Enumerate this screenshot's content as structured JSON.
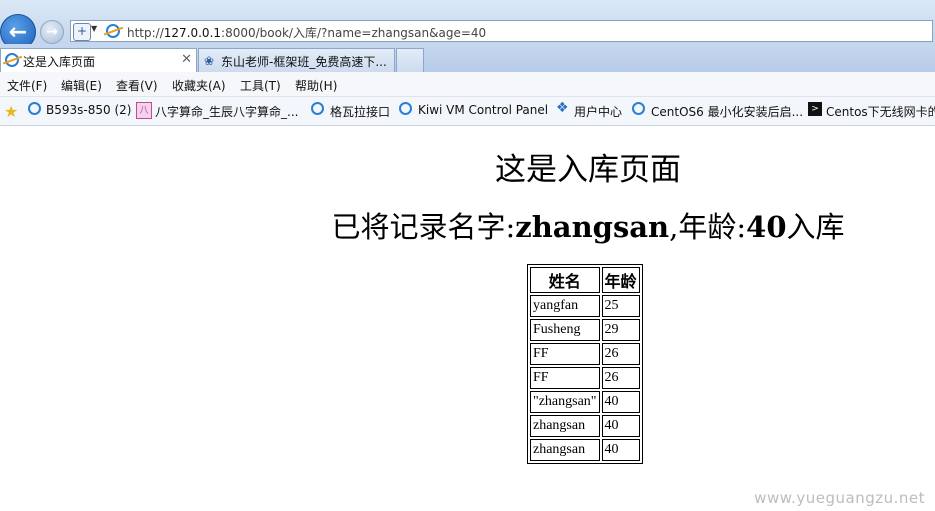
{
  "browser": {
    "address_url_prefix": "http://",
    "address_url_host": "127.0.0.1",
    "address_url_rest": ":8000/book/入库/?name=zhangsan&age=40",
    "tabs": [
      {
        "label": "这是入库页面",
        "active": true
      },
      {
        "label": "东山老师-框架班_免费高速下..."
      }
    ],
    "menu": [
      "文件(F)",
      "编辑(E)",
      "查看(V)",
      "收藏夹(A)",
      "工具(T)",
      "帮助(H)"
    ],
    "favorites": [
      "B593s-850 (2)",
      "八字算命_生辰八字算命_...",
      "格瓦拉接口",
      "Kiwi VM Control Panel",
      "用户中心",
      "CentOS6 最小化安装后启...",
      "Centos下无线网卡的"
    ],
    "icons": [
      "back-arrow-icon",
      "forward-arrow-icon",
      "ie-icon",
      "close-icon",
      "baidu-icon",
      "star-icon",
      "terminal-icon"
    ]
  },
  "page": {
    "title": "这是入库页面",
    "msg_prefix": "已将记录名字:",
    "msg_name": "zhangsan",
    "msg_mid": ",年龄:",
    "msg_age": "40",
    "msg_suffix": "入库",
    "table": {
      "headers": [
        "姓名",
        "年龄"
      ],
      "rows": [
        [
          "yangfan",
          "25"
        ],
        [
          "Fusheng",
          "29"
        ],
        [
          "FF",
          "26"
        ],
        [
          "FF",
          "26"
        ],
        [
          "\"zhangsan\"",
          "40"
        ],
        [
          "zhangsan",
          "40"
        ],
        [
          "zhangsan",
          "40"
        ]
      ]
    }
  },
  "watermark": "www.yueguangzu.net"
}
